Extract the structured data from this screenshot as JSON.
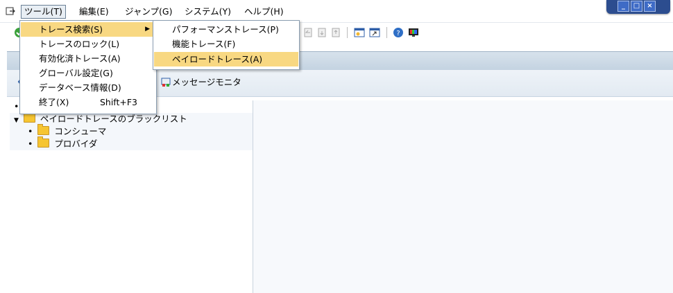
{
  "menubar": {
    "items": [
      {
        "label": "ツール(T)"
      },
      {
        "label": "編集(E)"
      },
      {
        "label": "ジャンプ(G)"
      },
      {
        "label": "システム(Y)"
      },
      {
        "label": "ヘルプ(H)"
      }
    ]
  },
  "window_controls": {
    "minimize": "_",
    "maximize": "□",
    "close": "×"
  },
  "tools_menu": {
    "items": [
      {
        "label": "トレース検索(S)"
      },
      {
        "label": "トレースのロック(L)"
      },
      {
        "label": "有効化済トレース(A)"
      },
      {
        "label": "グローバル設定(G)"
      },
      {
        "label": "データベース情報(D)"
      },
      {
        "label": "終了(X)",
        "accel": "Shift+F3"
      }
    ]
  },
  "trace_search_submenu": {
    "items": [
      {
        "label": "パフォーマンストレース(P)"
      },
      {
        "label": "機能トレース(F)"
      },
      {
        "label": "ペイロードトレース(A)"
      }
    ]
  },
  "app_toolbar": {
    "message_monitor": "メッセージモニタ"
  },
  "tree": {
    "root": "ペイロードトレースのブラックリスト",
    "children": [
      "コンシューマ",
      "プロバイダ"
    ]
  },
  "colors": {
    "highlight": "#f8d882",
    "header": "#c4d3e1",
    "window_blue": "#2c4d8f"
  }
}
